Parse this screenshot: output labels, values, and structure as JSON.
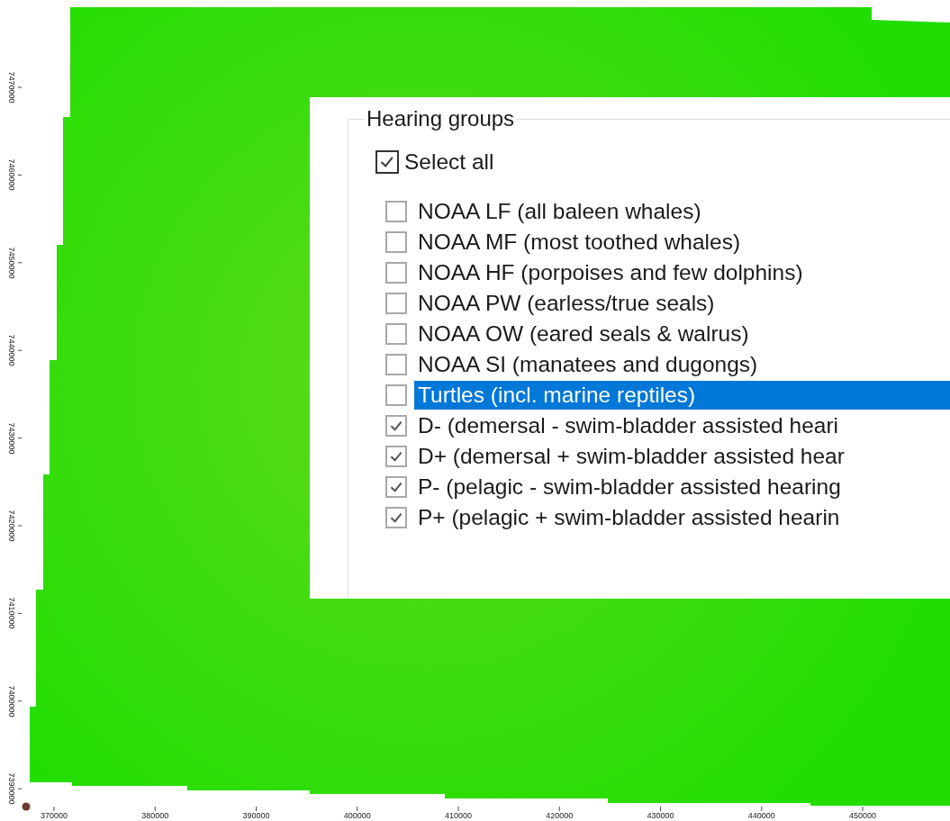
{
  "map": {
    "y_ticks": [
      "7470000",
      "7460000",
      "7450000",
      "7440000",
      "7430000",
      "7420000",
      "7410000",
      "7400000",
      "7390000"
    ],
    "x_ticks": [
      "370000",
      "380000",
      "390000",
      "400000",
      "410000",
      "420000",
      "430000",
      "440000",
      "450000"
    ]
  },
  "hearing_groups": {
    "title": "Hearing groups",
    "select_all": {
      "label": "Select all",
      "checked": true
    },
    "items": [
      {
        "label": "NOAA LF (all baleen whales)",
        "checked": false,
        "selected": false
      },
      {
        "label": "NOAA MF (most toothed whales)",
        "checked": false,
        "selected": false
      },
      {
        "label": "NOAA HF (porpoises and few dolphins)",
        "checked": false,
        "selected": false
      },
      {
        "label": "NOAA PW (earless/true seals)",
        "checked": false,
        "selected": false
      },
      {
        "label": "NOAA OW (eared seals & walrus)",
        "checked": false,
        "selected": false
      },
      {
        "label": "NOAA SI (manatees and dugongs)",
        "checked": false,
        "selected": false
      },
      {
        "label": "Turtles (incl. marine reptiles)",
        "checked": false,
        "selected": true
      },
      {
        "label": "D- (demersal - swim-bladder assisted heari",
        "checked": true,
        "selected": false
      },
      {
        "label": "D+ (demersal + swim-bladder assisted hear",
        "checked": true,
        "selected": false
      },
      {
        "label": "P- (pelagic - swim-bladder assisted hearing",
        "checked": true,
        "selected": false
      },
      {
        "label": "P+ (pelagic + swim-bladder assisted hearin",
        "checked": true,
        "selected": false
      }
    ]
  }
}
